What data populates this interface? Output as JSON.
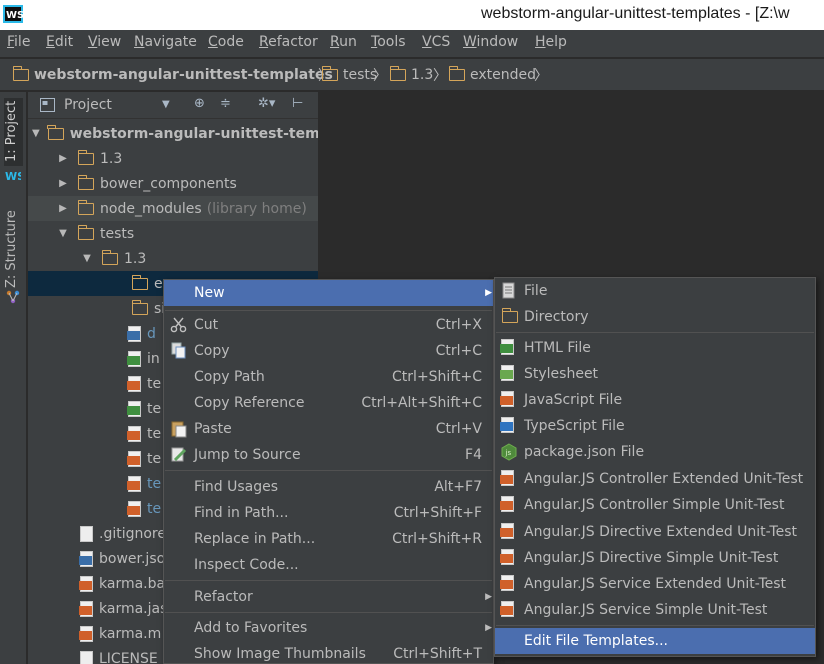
{
  "window": {
    "title": "webstorm-angular-unittest-templates - [Z:\\w"
  },
  "menubar": [
    "File",
    "Edit",
    "View",
    "Navigate",
    "Code",
    "Refactor",
    "Run",
    "Tools",
    "VCS",
    "Window",
    "Help"
  ],
  "breadcrumb": [
    "webstorm-angular-unittest-templates",
    "tests",
    "1.3",
    "extended"
  ],
  "sidebar": {
    "tab_project": "1: Project",
    "tab_structure": "Z: Structure"
  },
  "project_panel": {
    "view_label": "Project"
  },
  "tree": [
    {
      "label": "webstorm-angular-unittest-templ",
      "note": "",
      "icon": "folder-icon",
      "arrow": "▼",
      "indent": 0
    },
    {
      "label": "1.3",
      "note": "",
      "icon": "folder-icon",
      "arrow": "▶",
      "indent": 1
    },
    {
      "label": "bower_components",
      "note": "",
      "icon": "folder-icon",
      "arrow": "▶",
      "indent": 1
    },
    {
      "label": "node_modules",
      "note": "(library home)",
      "icon": "folder-icon",
      "arrow": "▶",
      "indent": 1
    },
    {
      "label": "tests",
      "note": "",
      "icon": "folder-icon",
      "arrow": "▼",
      "indent": 1
    },
    {
      "label": "1.3",
      "note": "",
      "icon": "folder-icon",
      "arrow": "▼",
      "indent": 2
    },
    {
      "label": "e",
      "note": "",
      "icon": "folder-icon",
      "arrow": "",
      "indent": 3
    },
    {
      "label": "si",
      "note": "",
      "icon": "folder-icon",
      "arrow": "",
      "indent": 3
    },
    {
      "label": "d",
      "note": "",
      "icon": "json-file-icon",
      "arrow": "",
      "indent": 3
    },
    {
      "label": "in",
      "note": "",
      "icon": "html-file-icon",
      "arrow": "",
      "indent": 3
    },
    {
      "label": "te",
      "note": "",
      "icon": "js-file-icon",
      "arrow": "",
      "indent": 3
    },
    {
      "label": "te",
      "note": "",
      "icon": "html-file-icon",
      "arrow": "",
      "indent": 3
    },
    {
      "label": "te",
      "note": "",
      "icon": "js-file-icon",
      "arrow": "",
      "indent": 3
    },
    {
      "label": "te",
      "note": "",
      "icon": "js-file-icon",
      "arrow": "",
      "indent": 3
    },
    {
      "label": "te",
      "note": "",
      "icon": "js-file-icon",
      "arrow": "",
      "indent": 3
    },
    {
      "label": "te",
      "note": "",
      "icon": "js-file-icon",
      "arrow": "",
      "indent": 3
    },
    {
      "label": ".gitignore",
      "note": "",
      "icon": "text-file-icon",
      "arrow": "",
      "indent": 1
    },
    {
      "label": "bower.json",
      "note": "",
      "icon": "json-file-icon",
      "arrow": "",
      "indent": 1
    },
    {
      "label": "karma.ba",
      "note": "",
      "icon": "js-file-icon",
      "arrow": "",
      "indent": 1
    },
    {
      "label": "karma.jas",
      "note": "",
      "icon": "js-file-icon",
      "arrow": "",
      "indent": 1
    },
    {
      "label": "karma.m",
      "note": "",
      "icon": "js-file-icon",
      "arrow": "",
      "indent": 1
    },
    {
      "label": "LICENSE",
      "note": "",
      "icon": "text-file-icon",
      "arrow": "",
      "indent": 1
    }
  ],
  "context_menu": [
    {
      "label": "New",
      "shortcut": "",
      "icon": "",
      "submenu": true
    },
    {
      "label": "Cut",
      "shortcut": "Ctrl+X",
      "icon": "scissors-icon",
      "submenu": false
    },
    {
      "label": "Copy",
      "shortcut": "Ctrl+C",
      "icon": "copy-icon",
      "submenu": false
    },
    {
      "label": "Copy Path",
      "shortcut": "Ctrl+Shift+C",
      "icon": "",
      "submenu": false
    },
    {
      "label": "Copy Reference",
      "shortcut": "Ctrl+Alt+Shift+C",
      "icon": "",
      "submenu": false
    },
    {
      "label": "Paste",
      "shortcut": "Ctrl+V",
      "icon": "paste-icon",
      "submenu": false
    },
    {
      "label": "Jump to Source",
      "shortcut": "F4",
      "icon": "pencil-icon",
      "submenu": false
    },
    {
      "label": "Find Usages",
      "shortcut": "Alt+F7",
      "icon": "",
      "submenu": false
    },
    {
      "label": "Find in Path...",
      "shortcut": "Ctrl+Shift+F",
      "icon": "",
      "submenu": false
    },
    {
      "label": "Replace in Path...",
      "shortcut": "Ctrl+Shift+R",
      "icon": "",
      "submenu": false
    },
    {
      "label": "Inspect Code...",
      "shortcut": "",
      "icon": "",
      "submenu": false
    },
    {
      "label": "Refactor",
      "shortcut": "",
      "icon": "",
      "submenu": true
    },
    {
      "label": "Add to Favorites",
      "shortcut": "",
      "icon": "",
      "submenu": true
    },
    {
      "label": "Show Image Thumbnails",
      "shortcut": "Ctrl+Shift+T",
      "icon": "",
      "submenu": false
    }
  ],
  "new_submenu": [
    {
      "label": "File",
      "icon": "file-icon"
    },
    {
      "label": "Directory",
      "icon": "folder-icon"
    },
    {
      "label": "HTML File",
      "icon": "html-file-icon"
    },
    {
      "label": "Stylesheet",
      "icon": "css-file-icon"
    },
    {
      "label": "JavaScript File",
      "icon": "js-file-icon"
    },
    {
      "label": "TypeScript File",
      "icon": "ts-file-icon"
    },
    {
      "label": "package.json File",
      "icon": "nodejs-icon"
    },
    {
      "label": "Angular.JS Controller Extended Unit-Test",
      "icon": "js-file-icon"
    },
    {
      "label": "Angular.JS Controller Simple Unit-Test",
      "icon": "js-file-icon"
    },
    {
      "label": "Angular.JS Directive Extended Unit-Test",
      "icon": "js-file-icon"
    },
    {
      "label": "Angular.JS Directive Simple Unit-Test",
      "icon": "js-file-icon"
    },
    {
      "label": "Angular.JS Service Extended Unit-Test",
      "icon": "js-file-icon"
    },
    {
      "label": "Angular.JS Service Simple Unit-Test",
      "icon": "js-file-icon"
    },
    {
      "label": "Edit File Templates...",
      "icon": ""
    }
  ]
}
